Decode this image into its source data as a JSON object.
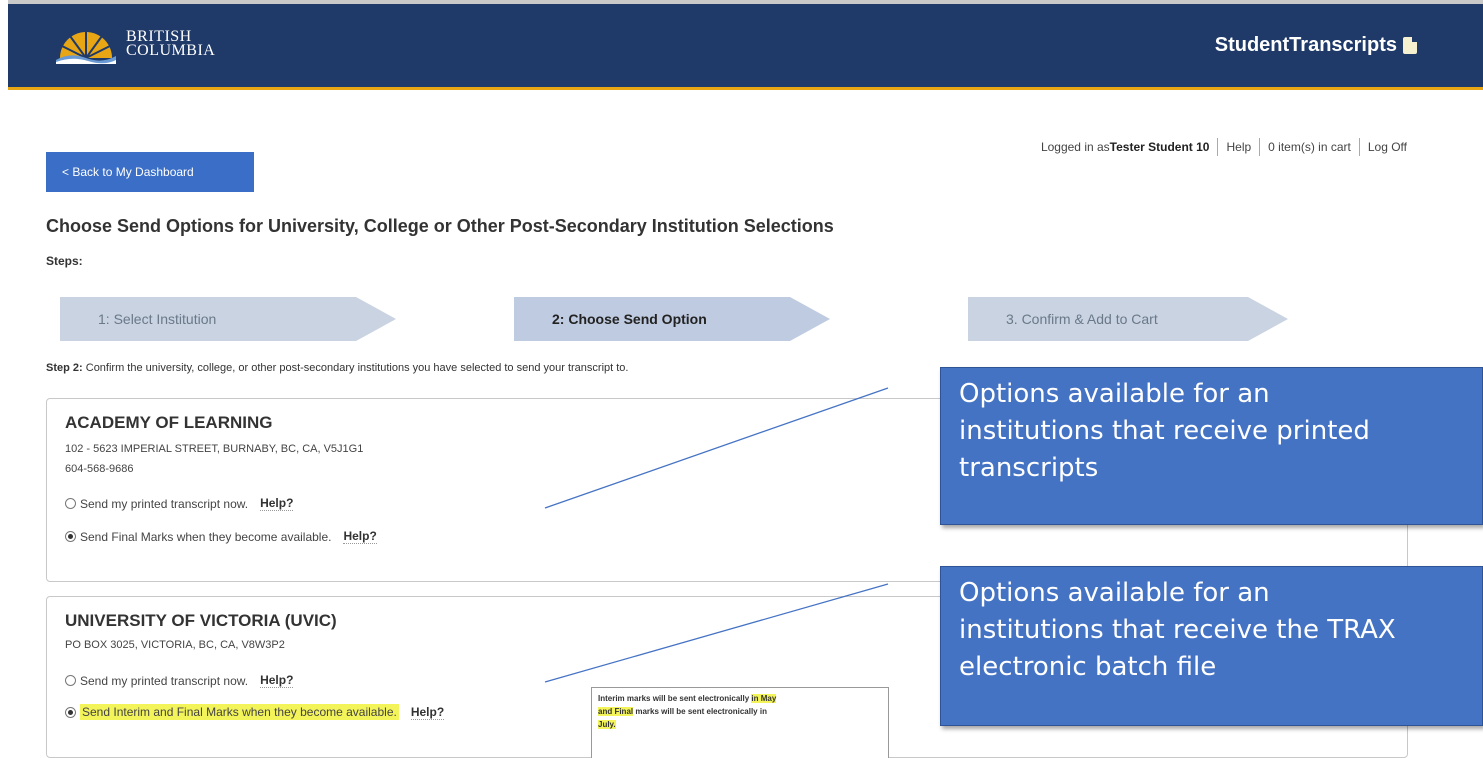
{
  "header": {
    "logo_line1": "BRITISH",
    "logo_line2": "COLUMBIA",
    "brand": "StudentTranscripts",
    "bg_color": "#1f3a68",
    "accent_color": "#e8a615"
  },
  "utility": {
    "logged_in_prefix": "Logged in as ",
    "user_name": "Tester Student 10",
    "help": "Help",
    "cart": "0 item(s) in cart",
    "logoff": "Log Off"
  },
  "back_button": "< Back to My Dashboard",
  "page_title": "Choose Send Options for University, College or Other Post-Secondary Institution Selections",
  "steps_label": "Steps:",
  "steps": [
    {
      "label": "1: Select Institution",
      "state": "inactive"
    },
    {
      "label": "2: Choose Send Option",
      "state": "active"
    },
    {
      "label": "3. Confirm & Add to Cart",
      "state": "inactive"
    }
  ],
  "step2_prefix": "Step 2:",
  "step2_text": " Confirm the university, college, or other post-secondary institutions you have selected to send your transcript to.",
  "institutions": [
    {
      "name": "ACADEMY OF LEARNING",
      "address": "102 - 5623 IMPERIAL STREET, BURNABY, BC, CA, V5J1G1",
      "phone": "604-568-9686",
      "options": [
        {
          "label": "Send my printed transcript now.",
          "help": "Help?",
          "checked": false
        },
        {
          "label": "Send Final Marks when they become available.",
          "help": "Help?",
          "checked": true
        }
      ]
    },
    {
      "name": "UNIVERSITY OF VICTORIA (UVIC)",
      "address": "PO BOX 3025, VICTORIA, BC, CA, V8W3P2",
      "options": [
        {
          "label": "Send my printed transcript now.",
          "help": "Help?",
          "checked": false
        },
        {
          "label": "Send Interim and Final Marks when they become available.",
          "help": "Help?",
          "checked": true
        }
      ],
      "tooltip": {
        "part1": "Interim marks will be sent electronically ",
        "part2": "in May",
        "part3": "and Final",
        "part4": " marks will be sent electronically in",
        "part5": "July."
      }
    }
  ],
  "callouts": [
    {
      "text_line1": "Options available for an",
      "text_line2": "institutions that receive printed",
      "text_line3": "transcripts"
    },
    {
      "text_line1": "Options available for an",
      "text_line2": "institutions that receive the TRAX",
      "text_line3": "electronic batch file"
    }
  ],
  "colors": {
    "step_active": "#bfcbe0",
    "step_inactive": "#c9d3e2",
    "button": "#3b6ec6",
    "callout": "#4573c4",
    "highlight": "#f3f35a"
  }
}
